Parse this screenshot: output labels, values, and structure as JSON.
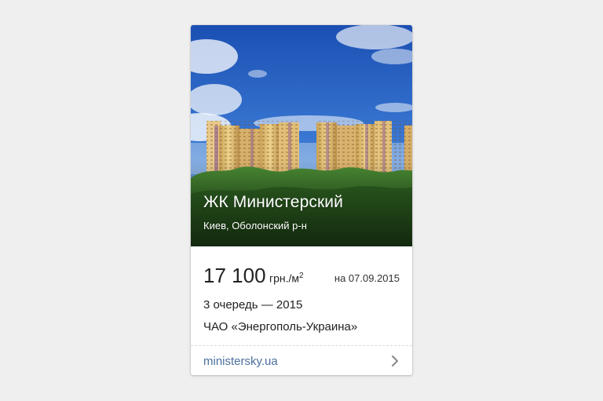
{
  "card": {
    "title": "ЖК Министерский",
    "location": "Киев, Оболонский р-н",
    "price": {
      "value": "17 100",
      "unit": "грн./м",
      "unit_power": "2",
      "date": "на 07.09.2015"
    },
    "queue": "3 очередь — 2015",
    "developer": "ЧАО «Энергополь-Украина»",
    "website": "ministersky.ua"
  },
  "colors": {
    "page_background": "#efefef",
    "link": "#4a6f9f",
    "sky": "#2f66c2",
    "forest": "#2f6a22"
  },
  "icons": {
    "footer_arrow": "chevron-right-icon"
  }
}
